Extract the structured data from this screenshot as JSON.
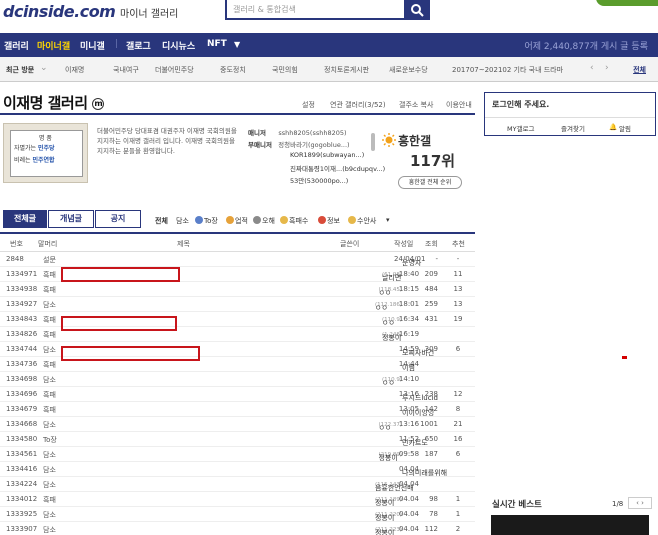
{
  "header": {
    "logo": "dcinside.com",
    "logo_sub": "마이너 갤러리",
    "search_placeholder": "갤러리 & 통합검색"
  },
  "nav": {
    "items": [
      "갤러리",
      "마이너갤",
      "미니갤",
      "갤로그",
      "디시뉴스",
      "NFT"
    ],
    "active": "마이너갤",
    "ticker": "어제 2,440,877개 게시 글 등록"
  },
  "recent": {
    "label": "최근 방문",
    "items": [
      "이재명",
      "국내여구",
      "더불어민주당",
      "중도정치",
      "국민의힘",
      "정치토론게시판",
      "새로운보수당",
      "201707~202102 기타 국내 드라마"
    ],
    "all": "전체"
  },
  "gallery": {
    "title": "이재명 갤러리",
    "badge": "m",
    "tools": [
      "설정",
      "연관 갤러리(3/52)",
      "갤주소 복사",
      "이용안내"
    ],
    "banner_l1": "명 품",
    "banner_l2a": "자멸가는",
    "banner_l2b": "민주당",
    "banner_l3a": "비례는",
    "banner_l3b": "민주연합",
    "description": "더불어민주당 당대표겸 대권주자 이재명 국회의원을 지지하는 이재명 갤러리 입니다. 이재명 국회의원을 지지하는 분들을 환영합니다.",
    "manager_label": "매니저",
    "manager_value": "sshh8205(sshh8205)",
    "submanager_label": "부매니저",
    "submanagers": [
      "정청바라기(gogoblue...)",
      "KOR1899(subwayan...)",
      "진짜대통령1이재...(b9cdupqv...)",
      "53만(530000po...)"
    ],
    "rank_label": "흥한갤",
    "rank_value": "117위",
    "rank_button": "흥한갤 전체 순위"
  },
  "sidebar": {
    "login_title": "로그인해 주세요.",
    "links": [
      "MY갤로그",
      "즐겨찾기",
      "알림"
    ],
    "live_title": "실시간 베스트",
    "live_page": "1/8",
    "live_arrows": "‹ ›"
  },
  "board": {
    "tabs": [
      "전체글",
      "개념글",
      "공지"
    ],
    "heads": [
      "전체",
      "담소",
      "To장",
      "업적",
      "오해",
      "흑패수",
      "정보",
      "수안사"
    ],
    "columns": [
      "번호",
      "말머리",
      "제목",
      "글쓴이",
      "작성일",
      "조회",
      "추천"
    ],
    "rows": [
      {
        "no": "2848",
        "head": "설문",
        "title": "점집을 자주 다닐 것 같은 스타는?",
        "count": "",
        "writer": "운영자",
        "ip": "",
        "date": "24/04/01",
        "views": "-",
        "rec": "-",
        "icon": "g",
        "notice": true
      },
      {
        "no": "1334971",
        "head": "흑패",
        "pre": "",
        "hl": "문재인",
        "post": "의 순가락 신공 시전",
        "count": "[4]",
        "writer": "날리면",
        "ip": "(61.98)",
        "date": "18:40",
        "views": "209",
        "rec": "11",
        "icon": ""
      },
      {
        "no": "1334938",
        "head": "흑패",
        "pre": "pk는 진짜 걱정임",
        "hl": "",
        "post": "",
        "count": "[3]",
        "writer": "ㅇㅇ",
        "ip": "(118.45)",
        "date": "18:15",
        "views": "484",
        "rec": "13",
        "icon": ""
      },
      {
        "no": "1334927",
        "head": "담소",
        "pre": "",
        "hl": "문재인",
        "post": " 일부러 투표날 결집시키나 생각도 듬",
        "count": "[2]",
        "writer": "ㅇㅇ",
        "ip": "(112.186)",
        "date": "18:01",
        "views": "259",
        "rec": "13",
        "icon": ""
      },
      {
        "no": "1334843",
        "head": "흑패",
        "pre": "아 ",
        "hl": "문재인",
        "post": "좀 조용히있으라고 해라!",
        "count": "[10]",
        "writer": "ㅇㅇ",
        "ip": "(110.9)",
        "date": "16:34",
        "views": "431",
        "rec": "19",
        "icon": ""
      },
      {
        "no": "1334826",
        "head": "흑패",
        "pre": "이번 사전투표는 예전과 다르게 보수도 집결했음",
        "hl": "",
        "post": "",
        "count": "",
        "writer": "정봉이",
        "ip": "(1.248)",
        "date": "16:19",
        "views": "",
        "rec": "",
        "icon": ""
      },
      {
        "no": "1334744",
        "head": "담소",
        "pre": "",
        "hl": "문재인",
        "post": "은 사전투표날에도 조지냐",
        "count": "[2]",
        "writer": "모찌사바건",
        "ip": "",
        "date": "14:59",
        "views": "309",
        "rec": "6",
        "icon": ""
      },
      {
        "no": "1334736",
        "head": "흑패",
        "pre": "꼭 이런 시기에 이따위 인법을 니가 시켰냐?",
        "hl": "",
        "post": "",
        "count": "",
        "writer": "이찜",
        "ip": "",
        "date": "14:44",
        "views": "",
        "rec": "",
        "icon": "y"
      },
      {
        "no": "1334698",
        "head": "담소",
        "pre": "이번 사전투표는 예전과 다르게 보수도 집결했음",
        "hl": "",
        "post": "",
        "count": "",
        "writer": "ㅇㅇ",
        "ip": "(110.9)",
        "date": "14:10",
        "views": "",
        "rec": "",
        "icon": ""
      },
      {
        "no": "1334696",
        "head": "흑패",
        "pre": "내가 불회동아가고 있는 정 하나 있다면 비례 의석 하…",
        "hl": "",
        "post": "",
        "count": "",
        "writer": "루시드lucid",
        "ip": "",
        "date": "13:16",
        "views": "238",
        "rec": "12",
        "icon": ""
      },
      {
        "no": "1334679",
        "head": "흑패",
        "pre": "이번선거에 대한 나의 개인적인 고찰",
        "hl": "",
        "post": "",
        "count": "",
        "writer": "이이이잉잉",
        "ip": "",
        "date": "13:05",
        "views": "142",
        "rec": "8",
        "icon": ""
      },
      {
        "no": "1334668",
        "head": "담소",
        "pre": "전은수 조국 만났네",
        "hl": "",
        "post": "",
        "count": "",
        "writer": "ㅇㅇ",
        "ip": "(122.37)",
        "date": "13:16",
        "views": "1001",
        "rec": "21",
        "icon": "r"
      },
      {
        "no": "1334580",
        "head": "To장",
        "pre": "이재명 지지자들 \"",
        "hl": "문재인",
        "post": " 제정신이냐…더불어플랫 방해",
        "count": "",
        "writer": "민카르도",
        "ip": "",
        "date": "11:52",
        "views": "650",
        "rec": "16",
        "icon": ""
      },
      {
        "no": "1334561",
        "head": "담소",
        "pre": "이재명의 비상금 추미에, 송영길 수박보단 영길이…",
        "hl": "",
        "post": "",
        "count": "",
        "writer": "정봉이",
        "ip": "(219.89)",
        "date": "09:58",
        "views": "187",
        "rec": "6",
        "icon": "b"
      },
      {
        "no": "1334416",
        "head": "담소",
        "pre": "이재성 유틉 열심히 보는데 경순하고 열심히하겠다고…",
        "hl": "",
        "post": "",
        "count": "",
        "writer": "나의미래를위해",
        "ip": "",
        "date": "04.04",
        "views": "",
        "rec": "",
        "icon": ""
      },
      {
        "no": "1334224",
        "head": "담소",
        "pre": "정말 대구 나서서 김할안 월드 패미 부서아하는거 아…",
        "hl": "",
        "post": "",
        "count": "",
        "writer": "음흉한언선배",
        "ip": "(115.143)",
        "date": "04.04",
        "views": "",
        "rec": "",
        "icon": ""
      },
      {
        "no": "1334012",
        "head": "흑패",
        "pre": "한동훈/윤석열 vs ",
        "hl": "문재인",
        "post": "",
        "count": "",
        "writer": "정봉이",
        "ip": "(211.189)",
        "date": "04.04",
        "views": "98",
        "rec": "1",
        "icon": ""
      },
      {
        "no": "1333925",
        "head": "담소",
        "pre": "클리앙 원래 이러냐? ㅇ ㅇ",
        "hl": "",
        "post": "",
        "count": "",
        "writer": "정봉이",
        "ip": "(211.220)",
        "date": "04.04",
        "views": "78",
        "rec": "1",
        "icon": ""
      },
      {
        "no": "1333907",
        "head": "담소",
        "pre": "새벽에 몇몇 선거토론회 본 후기(전부 읽어 주세요)",
        "hl": "",
        "post": "",
        "count": "",
        "writer": "정봉이",
        "ip": "(211.223)",
        "date": "04.04",
        "views": "112",
        "rec": "2",
        "icon": ""
      }
    ]
  },
  "colors": {
    "brand": "#29367c",
    "highlight_box": "#c8151b",
    "active_nav": "#ffd800"
  }
}
